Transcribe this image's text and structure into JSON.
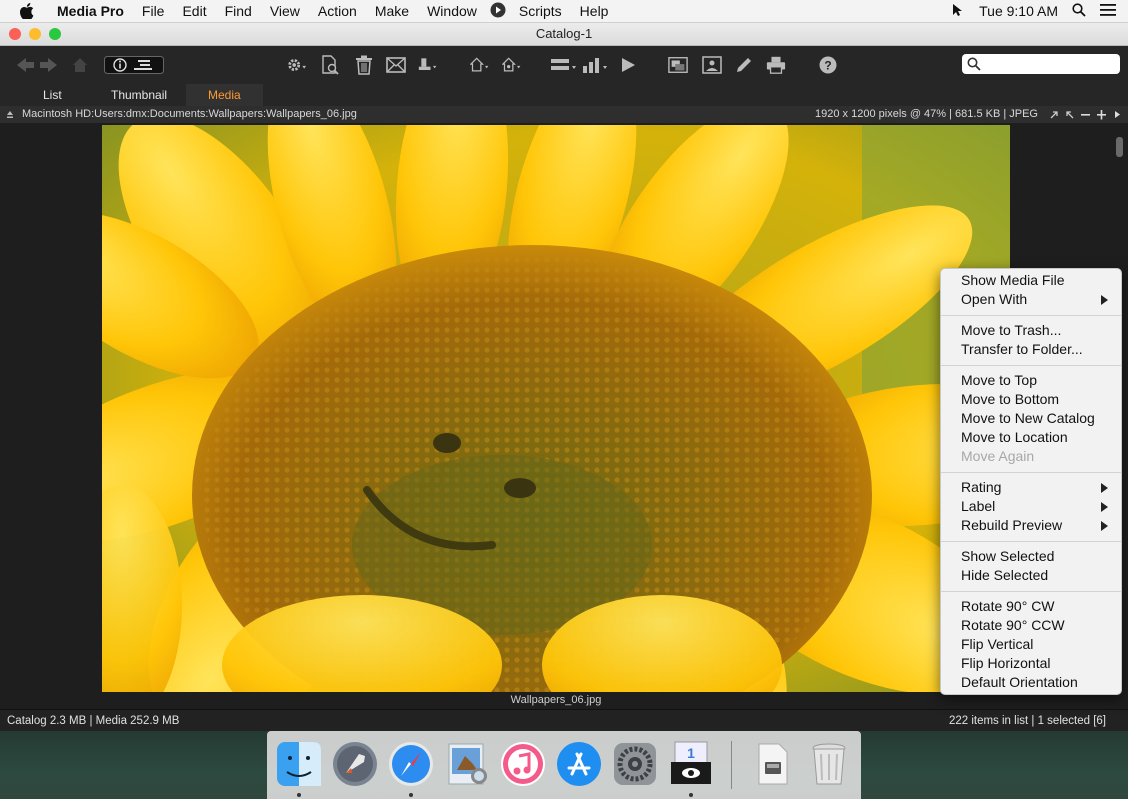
{
  "menubar": {
    "app_name": "Media Pro",
    "items": [
      "File",
      "Edit",
      "Find",
      "View",
      "Action",
      "Make",
      "Window",
      "Scripts",
      "Help"
    ],
    "clock": "Tue 9:10 AM"
  },
  "window": {
    "title": "Catalog-1"
  },
  "tabs": {
    "list": "List",
    "thumbnail": "Thumbnail",
    "media": "Media"
  },
  "pathbar": {
    "path": "Macintosh HD:Users:dmx:Documents:Wallpapers:Wallpapers_06.jpg",
    "info": "1920 x 1200 pixels @ 47%  |  681.5 KB  |  JPEG"
  },
  "viewer": {
    "caption": "Wallpapers_06.jpg"
  },
  "statusbar": {
    "left": "Catalog  2.3 MB  |  Media 252.9 MB",
    "right": "222 items in list  |  1 selected [6]"
  },
  "context_menu": {
    "items": [
      {
        "label": "Show Media File"
      },
      {
        "label": "Open With",
        "submenu": true
      },
      {
        "label": "Move to Trash..."
      },
      {
        "label": "Transfer to Folder..."
      },
      {
        "label": "Move to Top"
      },
      {
        "label": "Move to Bottom"
      },
      {
        "label": "Move to New Catalog"
      },
      {
        "label": "Move to Location"
      },
      {
        "label": "Move Again",
        "disabled": true
      },
      {
        "label": "Rating",
        "submenu": true
      },
      {
        "label": "Label",
        "submenu": true
      },
      {
        "label": "Rebuild Preview",
        "submenu": true
      },
      {
        "label": "Show Selected"
      },
      {
        "label": "Hide Selected"
      },
      {
        "label": "Rotate 90° CW"
      },
      {
        "label": "Rotate 90° CCW"
      },
      {
        "label": "Flip Vertical"
      },
      {
        "label": "Flip Horizontal"
      },
      {
        "label": "Default Orientation"
      }
    ]
  },
  "dock": {
    "apps": [
      "finder-icon",
      "launchpad-icon",
      "safari-icon",
      "preview-icon",
      "itunes-icon",
      "app-store-icon",
      "system-preferences-icon",
      "media-pro-icon",
      "documents-folder-icon",
      "trash-icon"
    ]
  },
  "colors": {
    "accent_tab": "#ff9a33",
    "close": "#fc5f57",
    "minimize": "#fdbc2e",
    "zoom": "#2ac840"
  }
}
